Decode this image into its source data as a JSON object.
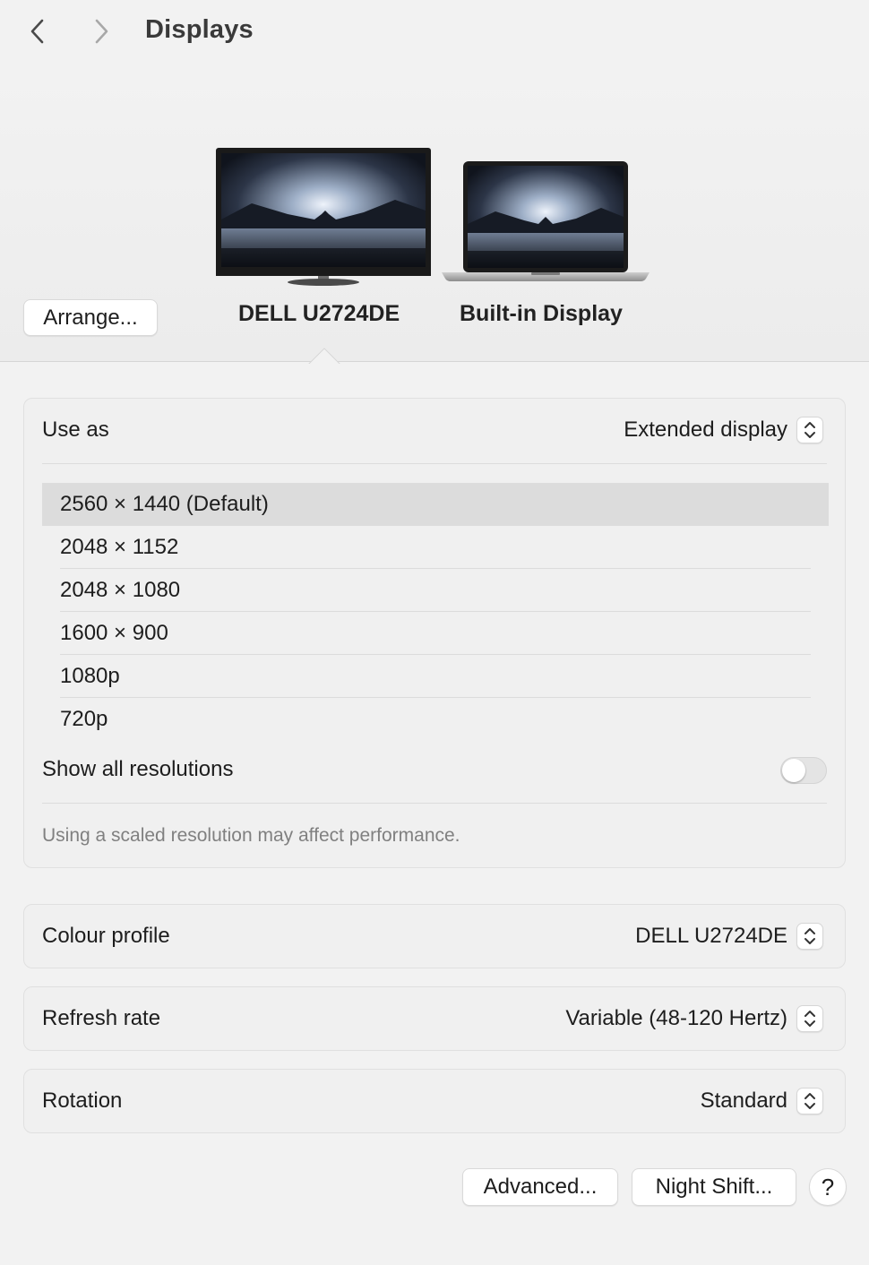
{
  "window": {
    "title": "Displays"
  },
  "header": {
    "arrange_label": "Arrange...",
    "displays": [
      {
        "name": "DELL U2724DE",
        "selected": true
      },
      {
        "name": "Built-in Display",
        "selected": false
      }
    ]
  },
  "settings": {
    "use_as": {
      "label": "Use as",
      "value": "Extended display"
    },
    "resolutions": [
      {
        "label": "2560 × 1440 (Default)",
        "selected": true
      },
      {
        "label": "2048 × 1152",
        "selected": false
      },
      {
        "label": "2048 × 1080",
        "selected": false
      },
      {
        "label": "1600 × 900",
        "selected": false
      },
      {
        "label": "1080p",
        "selected": false
      },
      {
        "label": "720p",
        "selected": false
      }
    ],
    "show_all": {
      "label": "Show all resolutions",
      "on": false
    },
    "note": "Using a scaled resolution may affect performance.",
    "colour_profile": {
      "label": "Colour profile",
      "value": "DELL U2724DE"
    },
    "refresh_rate": {
      "label": "Refresh rate",
      "value": "Variable (48-120 Hertz)"
    },
    "rotation": {
      "label": "Rotation",
      "value": "Standard"
    }
  },
  "footer": {
    "advanced_label": "Advanced...",
    "night_shift_label": "Night Shift...",
    "help_label": "?"
  },
  "icons": {
    "back": "chevron-left-icon",
    "forward": "chevron-right-icon",
    "stepper": "up-down-chevron-icon"
  },
  "colors": {
    "background": "#f2f2f2",
    "selected_row": "#dcdcdc",
    "note_text": "#808080"
  }
}
